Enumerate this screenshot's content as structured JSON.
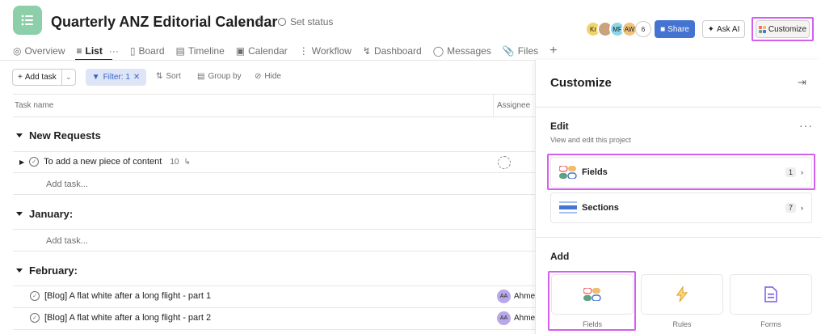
{
  "header": {
    "title": "Quarterly ANZ Editorial Calendar",
    "set_status": "Set status",
    "avatars": [
      {
        "initials": "Kr",
        "color": "#f1d469"
      },
      {
        "initials": "",
        "color": "#c9a27e"
      },
      {
        "initials": "MF",
        "color": "#8ad7e8"
      },
      {
        "initials": "AW",
        "color": "#f0c27a"
      }
    ],
    "member_count": "6",
    "share": "Share",
    "ask_ai": "Ask AI",
    "customize": "Customize"
  },
  "tabs": [
    "Overview",
    "List",
    "Board",
    "Timeline",
    "Calendar",
    "Workflow",
    "Dashboard",
    "Messages",
    "Files"
  ],
  "toolbar": {
    "add_task": "Add task",
    "filter": "Filter: 1",
    "sort": "Sort",
    "group_by": "Group by",
    "hide": "Hide"
  },
  "table": {
    "col_task": "Task name",
    "col_assignee": "Assignee",
    "add_task_placeholder": "Add task...",
    "sections": [
      {
        "name": "New Requests",
        "tasks": [
          {
            "name": "To add a new piece of content",
            "subtasks": "10"
          }
        ]
      },
      {
        "name": "January:",
        "tasks": []
      },
      {
        "name": "February:",
        "tasks": [
          {
            "name": "[Blog] A flat white after a long flight - part 1",
            "assignee_initials": "AA",
            "assignee": "Ahmet"
          },
          {
            "name": "[Blog] A flat white after a long flight - part 2",
            "assignee_initials": "AA",
            "assignee": "Ahmet"
          }
        ]
      }
    ]
  },
  "panel": {
    "title": "Customize",
    "edit_heading": "Edit",
    "edit_sub": "View and edit this project",
    "fields": {
      "label": "Fields",
      "count": "1"
    },
    "sections": {
      "label": "Sections",
      "count": "7"
    },
    "add_heading": "Add",
    "add_tiles": [
      "Fields",
      "Rules",
      "Forms"
    ]
  },
  "colors": {
    "accent": "#4573d2",
    "highlight": "#d45ef0",
    "project_icon": "#8ccfa9"
  }
}
